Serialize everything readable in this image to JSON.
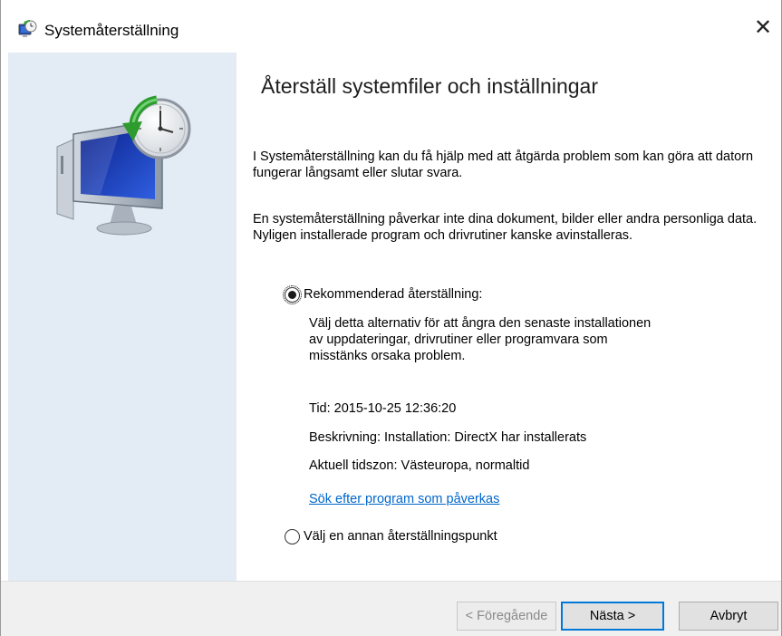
{
  "window": {
    "title": "Systemåterställning",
    "close_glyph": "✕"
  },
  "icons": {
    "app_icon": "system-restore-icon",
    "hero_icon": "monitor-clock-restore-icon"
  },
  "main": {
    "heading": "Återställ systemfiler och inställningar",
    "paragraph1": "I Systemåterställning kan du få hjälp med att åtgärda problem som kan göra att datorn fungerar långsamt eller slutar svara.",
    "paragraph2": "En systemåterställning påverkar inte dina dokument, bilder eller andra personliga data. Nyligen installerade program och drivrutiner kanske avinstalleras.",
    "option_recommended": {
      "label": "Rekommenderad återställning:",
      "selected": true,
      "description": "Välj detta alternativ för att ångra den senaste installationen av uppdateringar, drivrutiner eller programvara som misstänks orsaka problem.",
      "time": "Tid: 2015-10-25 12:36:20",
      "description_line": "Beskrivning: Installation: DirectX har installerats",
      "timezone": "Aktuell tidszon: Västeuropa, normaltid",
      "link": "Sök efter program som påverkas"
    },
    "option_other": {
      "label": "Välj en annan återställningspunkt",
      "selected": false
    }
  },
  "footer": {
    "prev_label": "< Föregående",
    "next_label": "Nästa >",
    "cancel_label": "Avbryt"
  },
  "colors": {
    "sidebar": "#e3ebf4",
    "link": "#0066cc",
    "focus_border": "#0078d7",
    "footer": "#f0f0f0"
  }
}
